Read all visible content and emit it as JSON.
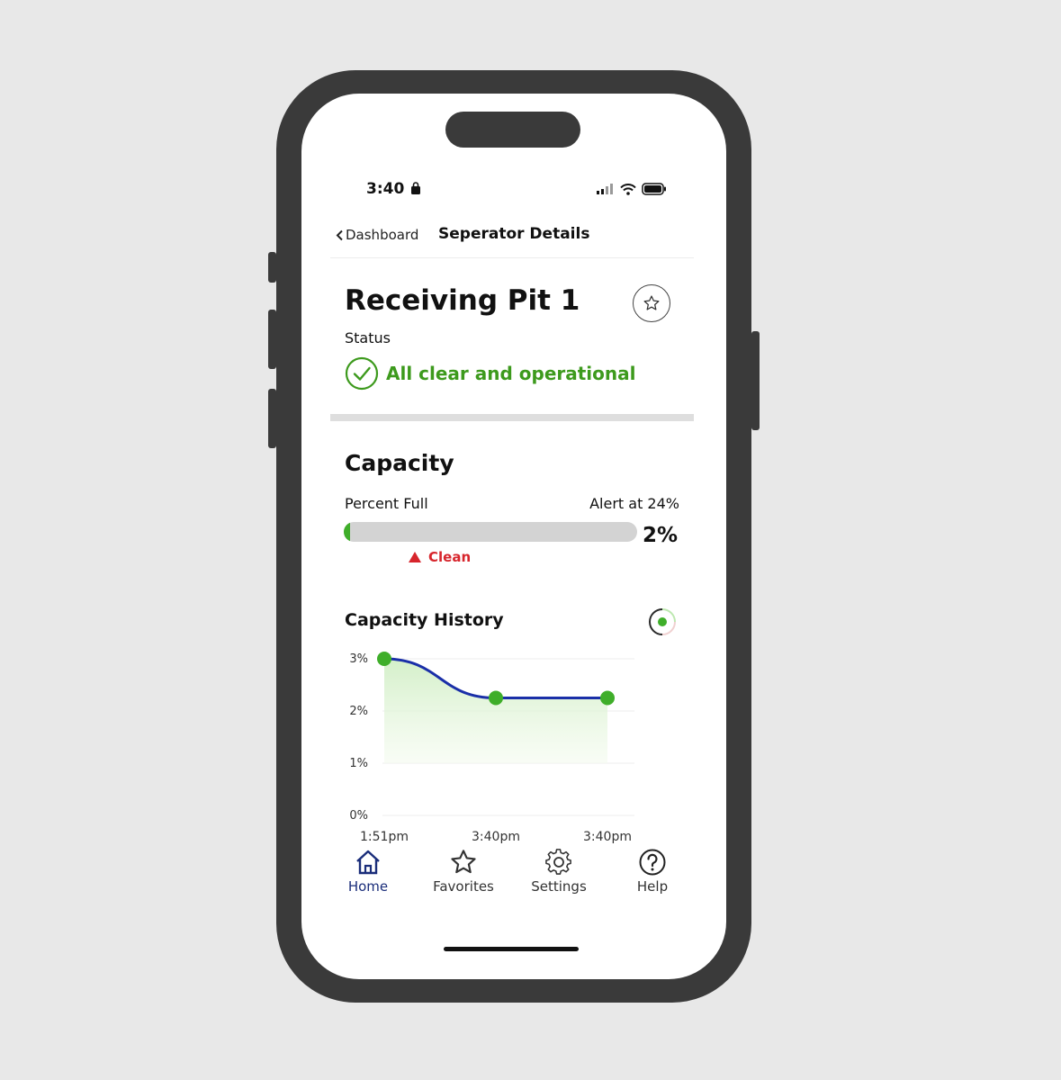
{
  "status_bar": {
    "time": "3:40"
  },
  "nav": {
    "back_label": "Dashboard",
    "title": "Seperator Details"
  },
  "header": {
    "title": "Receiving Pit 1",
    "status_label": "Status",
    "status_text": "All clear and operational"
  },
  "capacity": {
    "title": "Capacity",
    "percent_label": "Percent Full",
    "alert_label": "Alert at 24%",
    "value_text": "2%",
    "fill_percent": 2,
    "clean_label": "Clean"
  },
  "history": {
    "title": "Capacity History"
  },
  "chart_data": {
    "type": "area",
    "x": [
      "1:51pm",
      "3:40pm",
      "3:40pm"
    ],
    "y_ticks": [
      "0%",
      "1%",
      "2%",
      "3%"
    ],
    "values": [
      3.0,
      2.25,
      2.25
    ],
    "ylim": [
      0,
      3
    ],
    "grid": true
  },
  "tabbar": {
    "items": [
      {
        "label": "Home",
        "icon": "home-icon"
      },
      {
        "label": "Favorites",
        "icon": "star-icon"
      },
      {
        "label": "Settings",
        "icon": "gear-icon"
      },
      {
        "label": "Help",
        "icon": "help-icon"
      }
    ]
  },
  "colors": {
    "accent_green": "#3fae2a",
    "status_green": "#3d9a1d",
    "alert_red": "#d7252c",
    "line_blue": "#1a2fa8",
    "active_tab": "#1a2d7a"
  }
}
